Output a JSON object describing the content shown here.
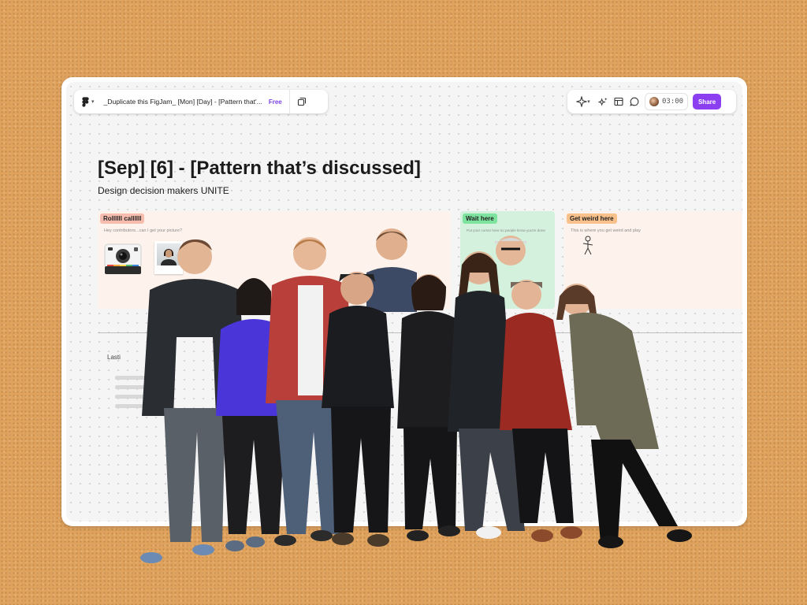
{
  "toolbar": {
    "file_title": "_Duplicate this FigJam_ [Mon] [Day] - [Pattern that'...",
    "plan_badge": "Free",
    "timer": "03:00",
    "share_label": "Share",
    "icons": [
      "figma-icon",
      "pages-icon",
      "sparkle-tool-icon",
      "ai-sparkles-icon",
      "layout-icon",
      "comment-icon"
    ]
  },
  "board": {
    "title": "[Sep] [6] - [Pattern that’s discussed]",
    "subtitle": "Design decision makers UNITE"
  },
  "sections": [
    {
      "label": "Rollllll callllll",
      "hint": "Hey contributors...can I get your picture?",
      "color": "#f6bdae"
    },
    {
      "label": "Wait here",
      "hint": "Put your cursor here so people know you're done",
      "color": "#7fe3a0"
    },
    {
      "label": "Get weird here",
      "hint": "This is where you get weird and play",
      "color": "#f8c08b"
    }
  ],
  "notes": {
    "lasting": "Lasti"
  },
  "colors": {
    "background": "#e0a35e",
    "accent": "#8b3ff0"
  }
}
